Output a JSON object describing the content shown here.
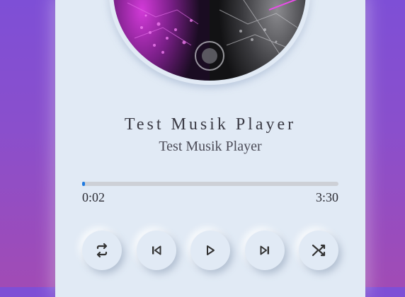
{
  "player": {
    "title": "Test Musik Player",
    "artist": "Test Musik Player",
    "progress_fraction": 0.01,
    "current_time": "0:02",
    "duration": "3:30"
  },
  "controls": [
    {
      "name": "repeat-button",
      "icon": "repeat-icon"
    },
    {
      "name": "previous-button",
      "icon": "skip-previous-icon"
    },
    {
      "name": "play-button",
      "icon": "play-icon"
    },
    {
      "name": "next-button",
      "icon": "skip-next-icon"
    },
    {
      "name": "shuffle-button",
      "icon": "shuffle-icon"
    }
  ],
  "colors": {
    "accent": "#1f7ae0",
    "card": "#e1eaf5",
    "background_top": "#7e4fd6",
    "background_bottom": "#a14bb5"
  }
}
